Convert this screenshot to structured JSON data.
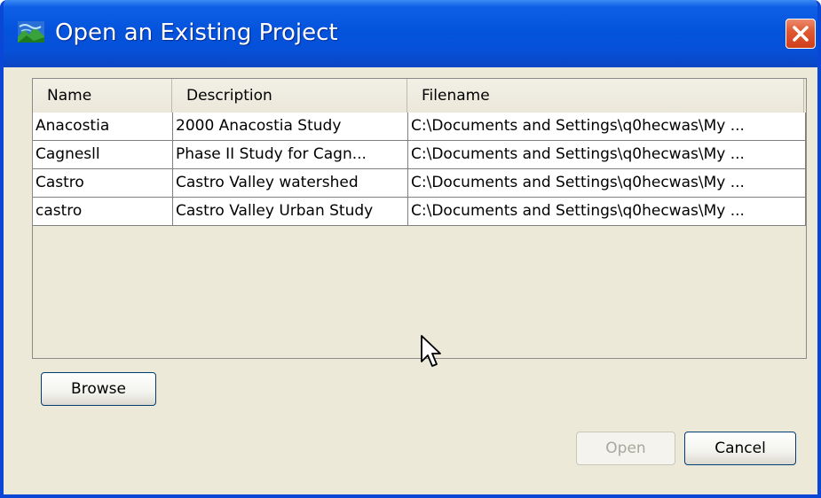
{
  "window": {
    "title": "Open an Existing Project",
    "title_color": "#ffffff",
    "titlebar_color": "#0453dc",
    "close_button_color": "#e05a34"
  },
  "icons": {
    "app": "project-app-icon",
    "close": "close-icon",
    "cursor": "mouse-pointer-icon"
  },
  "table": {
    "columns": [
      "Name",
      "Description",
      "Filename"
    ],
    "rows": [
      [
        "Anacostia",
        "2000 Anacostia Study",
        "C:\\Documents and Settings\\q0hecwas\\My ..."
      ],
      [
        "Cagnesll",
        "Phase II Study for Cagn...",
        "C:\\Documents and Settings\\q0hecwas\\My ..."
      ],
      [
        "Castro",
        "Castro Valley watershed",
        "C:\\Documents and Settings\\q0hecwas\\My ..."
      ],
      [
        "castro",
        "Castro Valley Urban Study",
        "C:\\Documents and Settings\\q0hecwas\\My ..."
      ]
    ]
  },
  "buttons": {
    "browse": "Browse",
    "open": "Open",
    "cancel": "Cancel",
    "open_enabled": false
  }
}
